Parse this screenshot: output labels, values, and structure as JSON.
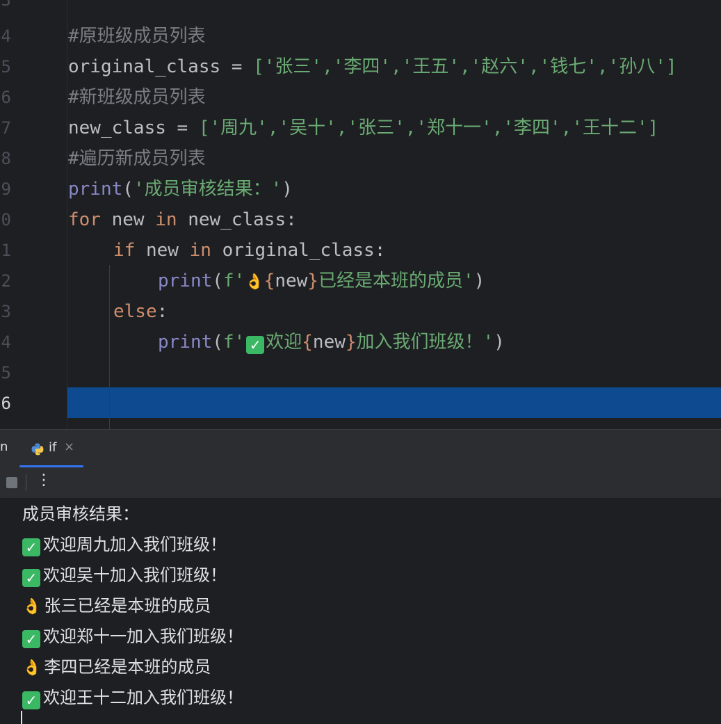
{
  "editor": {
    "line_numbers": [
      "3",
      "4",
      "5",
      "6",
      "7",
      "8",
      "9",
      "0",
      "1",
      "2",
      "3",
      "4",
      "5",
      "6"
    ],
    "current_line_number": "6",
    "comment_original": "#原班级成员列表",
    "var_original": "original_class",
    "original_list": "['张三','李四','王五','赵六','钱七','孙八']",
    "comment_new": "#新班级成员列表",
    "var_new": "new_class",
    "new_list": "['周九','吴十','张三','郑十一','李四','王十二']",
    "comment_loop": "#遍历新成员列表",
    "print_fn": "print",
    "header_string": "'成员审核结果：'",
    "kw_for": "for",
    "loop_var": "new",
    "kw_in": "in",
    "kw_if": "if",
    "kw_else": "else",
    "fstring_prefix": "f'",
    "fstring_var": "new",
    "member_text": "已经是本班的成员'",
    "welcome_text_a": "欢迎",
    "welcome_text_b": "加入我们班级！'",
    "eq": " = ",
    "colon": ":",
    "paren_open": "(",
    "paren_close": ")",
    "brace_open": "{",
    "brace_close": "}"
  },
  "tool_window": {
    "left_tab_stub": "n",
    "run_tab_label": "if",
    "close_glyph": "×",
    "more_glyph": "⋮"
  },
  "console": {
    "lines": [
      {
        "icon": "",
        "text": "成员审核结果："
      },
      {
        "icon": "check",
        "text": "欢迎周九加入我们班级！"
      },
      {
        "icon": "check",
        "text": "欢迎吴十加入我们班级！"
      },
      {
        "icon": "ok-hand",
        "text": "张三已经是本班的成员"
      },
      {
        "icon": "check",
        "text": "欢迎郑十一加入我们班级！"
      },
      {
        "icon": "ok-hand",
        "text": "李四已经是本班的成员"
      },
      {
        "icon": "check",
        "text": "欢迎王十二加入我们班级！"
      }
    ]
  },
  "icons": {
    "check_glyph": "✓",
    "ok_hand_glyph": "👌"
  },
  "colors": {
    "keyword": "#cf8e6d",
    "string": "#6aab73",
    "builtin": "#8888c6",
    "comment": "#7a7e85",
    "caret_row": "#0d4a90",
    "accent": "#3574f0",
    "check_bg": "#3bb864"
  }
}
